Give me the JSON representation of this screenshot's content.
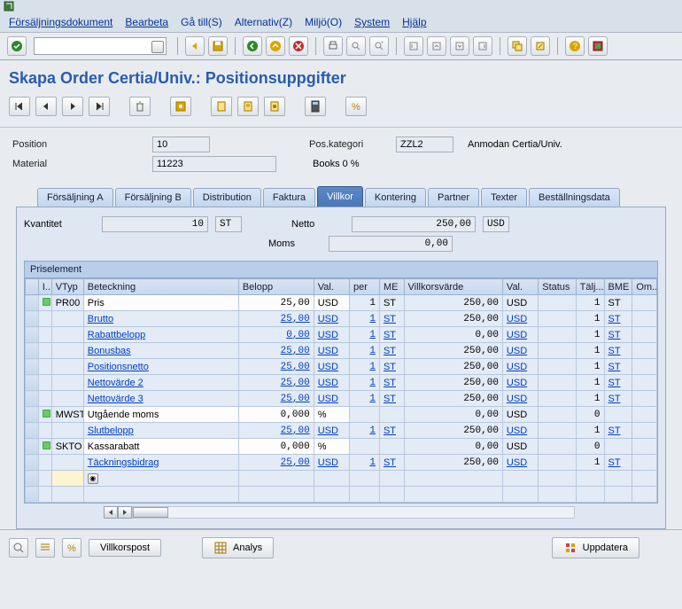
{
  "menubar": [
    "Försäljningsdokument",
    "Bearbeta",
    "Gå till(S)",
    "Alternativ(Z)",
    "Miljö(O)",
    "System",
    "Hjälp"
  ],
  "page_title": "Skapa Order Certia/Univ.: Positionsuppgifter",
  "header": {
    "position_label": "Position",
    "position_value": "10",
    "material_label": "Material",
    "material_value": "11223",
    "poskat_label": "Pos.kategori",
    "poskat_value": "ZZL2",
    "poskat_text": "Anmodan Certia/Univ.",
    "books_text": "Books 0 %"
  },
  "tabs": [
    "Försäljning A",
    "Försäljning B",
    "Distribution",
    "Faktura",
    "Villkor",
    "Kontering",
    "Partner",
    "Texter",
    "Beställningsdata"
  ],
  "active_tab": 4,
  "summary": {
    "kvant_label": "Kvantitet",
    "kvant_value": "10",
    "kvant_unit": "ST",
    "netto_label": "Netto",
    "netto_value": "250,00",
    "netto_unit": "USD",
    "moms_label": "Moms",
    "moms_value": "0,00"
  },
  "grid": {
    "title": "Priselement",
    "headers": [
      "I...",
      "VTyp",
      "Beteckning",
      "Belopp",
      "Val.",
      "per",
      "ME",
      "Villkorsvärde",
      "Val.",
      "Status",
      "Tälj...",
      "BME",
      "Om..."
    ],
    "rows": [
      {
        "status": "g",
        "vtyp": "PR00",
        "bet": "Pris",
        "bel": "25,00",
        "val": "USD",
        "per": "1",
        "me": "ST",
        "vv": "250,00",
        "val2": "USD",
        "talj": "1",
        "bme": "ST",
        "link": false,
        "white": true
      },
      {
        "status": "",
        "vtyp": "",
        "bet": "Brutto",
        "bel": "25,00",
        "val": "USD",
        "per": "1",
        "me": "ST",
        "vv": "250,00",
        "val2": "USD",
        "talj": "1",
        "bme": "ST",
        "link": true
      },
      {
        "status": "",
        "vtyp": "",
        "bet": "Rabattbelopp",
        "bel": "0,00",
        "val": "USD",
        "per": "1",
        "me": "ST",
        "vv": "0,00",
        "val2": "USD",
        "talj": "1",
        "bme": "ST",
        "link": true
      },
      {
        "status": "",
        "vtyp": "",
        "bet": "Bonusbas",
        "bel": "25,00",
        "val": "USD",
        "per": "1",
        "me": "ST",
        "vv": "250,00",
        "val2": "USD",
        "talj": "1",
        "bme": "ST",
        "link": true
      },
      {
        "status": "",
        "vtyp": "",
        "bet": "Positionsnetto",
        "bel": "25,00",
        "val": "USD",
        "per": "1",
        "me": "ST",
        "vv": "250,00",
        "val2": "USD",
        "talj": "1",
        "bme": "ST",
        "link": true
      },
      {
        "status": "",
        "vtyp": "",
        "bet": "Nettovärde 2",
        "bel": "25,00",
        "val": "USD",
        "per": "1",
        "me": "ST",
        "vv": "250,00",
        "val2": "USD",
        "talj": "1",
        "bme": "ST",
        "link": true
      },
      {
        "status": "",
        "vtyp": "",
        "bet": "Nettovärde 3",
        "bel": "25,00",
        "val": "USD",
        "per": "1",
        "me": "ST",
        "vv": "250,00",
        "val2": "USD",
        "talj": "1",
        "bme": "ST",
        "link": true
      },
      {
        "status": "g",
        "vtyp": "MWST",
        "bet": "Utgående moms",
        "bel": "0,000",
        "val": "%",
        "per": "",
        "me": "",
        "vv": "0,00",
        "val2": "USD",
        "talj": "0",
        "bme": "",
        "link": false,
        "white": true
      },
      {
        "status": "",
        "vtyp": "",
        "bet": "Slutbelopp",
        "bel": "25,00",
        "val": "USD",
        "per": "1",
        "me": "ST",
        "vv": "250,00",
        "val2": "USD",
        "talj": "1",
        "bme": "ST",
        "link": true
      },
      {
        "status": "g",
        "vtyp": "SKTO",
        "bet": "Kassarabatt",
        "bel": "0,000",
        "val": "%",
        "per": "",
        "me": "",
        "vv": "0,00",
        "val2": "USD",
        "talj": "0",
        "bme": "",
        "link": false,
        "white": true
      },
      {
        "status": "",
        "vtyp": "",
        "bet": "Täckningsbidrag",
        "bel": "25,00",
        "val": "USD",
        "per": "1",
        "me": "ST",
        "vv": "250,00",
        "val2": "USD",
        "talj": "1",
        "bme": "ST",
        "link": true
      },
      {
        "status": "",
        "vtyp": "",
        "bet": "",
        "bel": "",
        "val": "",
        "per": "",
        "me": "",
        "vv": "",
        "val2": "",
        "talj": "",
        "bme": "",
        "cream": true,
        "f4": true
      },
      {
        "status": "",
        "vtyp": "",
        "bet": "",
        "bel": "",
        "val": "",
        "per": "",
        "me": "",
        "vv": "",
        "val2": "",
        "talj": "",
        "bme": ""
      }
    ]
  },
  "buttons": {
    "villkorspost": "Villkorspost",
    "analys": "Analys",
    "uppdatera": "Uppdatera"
  }
}
